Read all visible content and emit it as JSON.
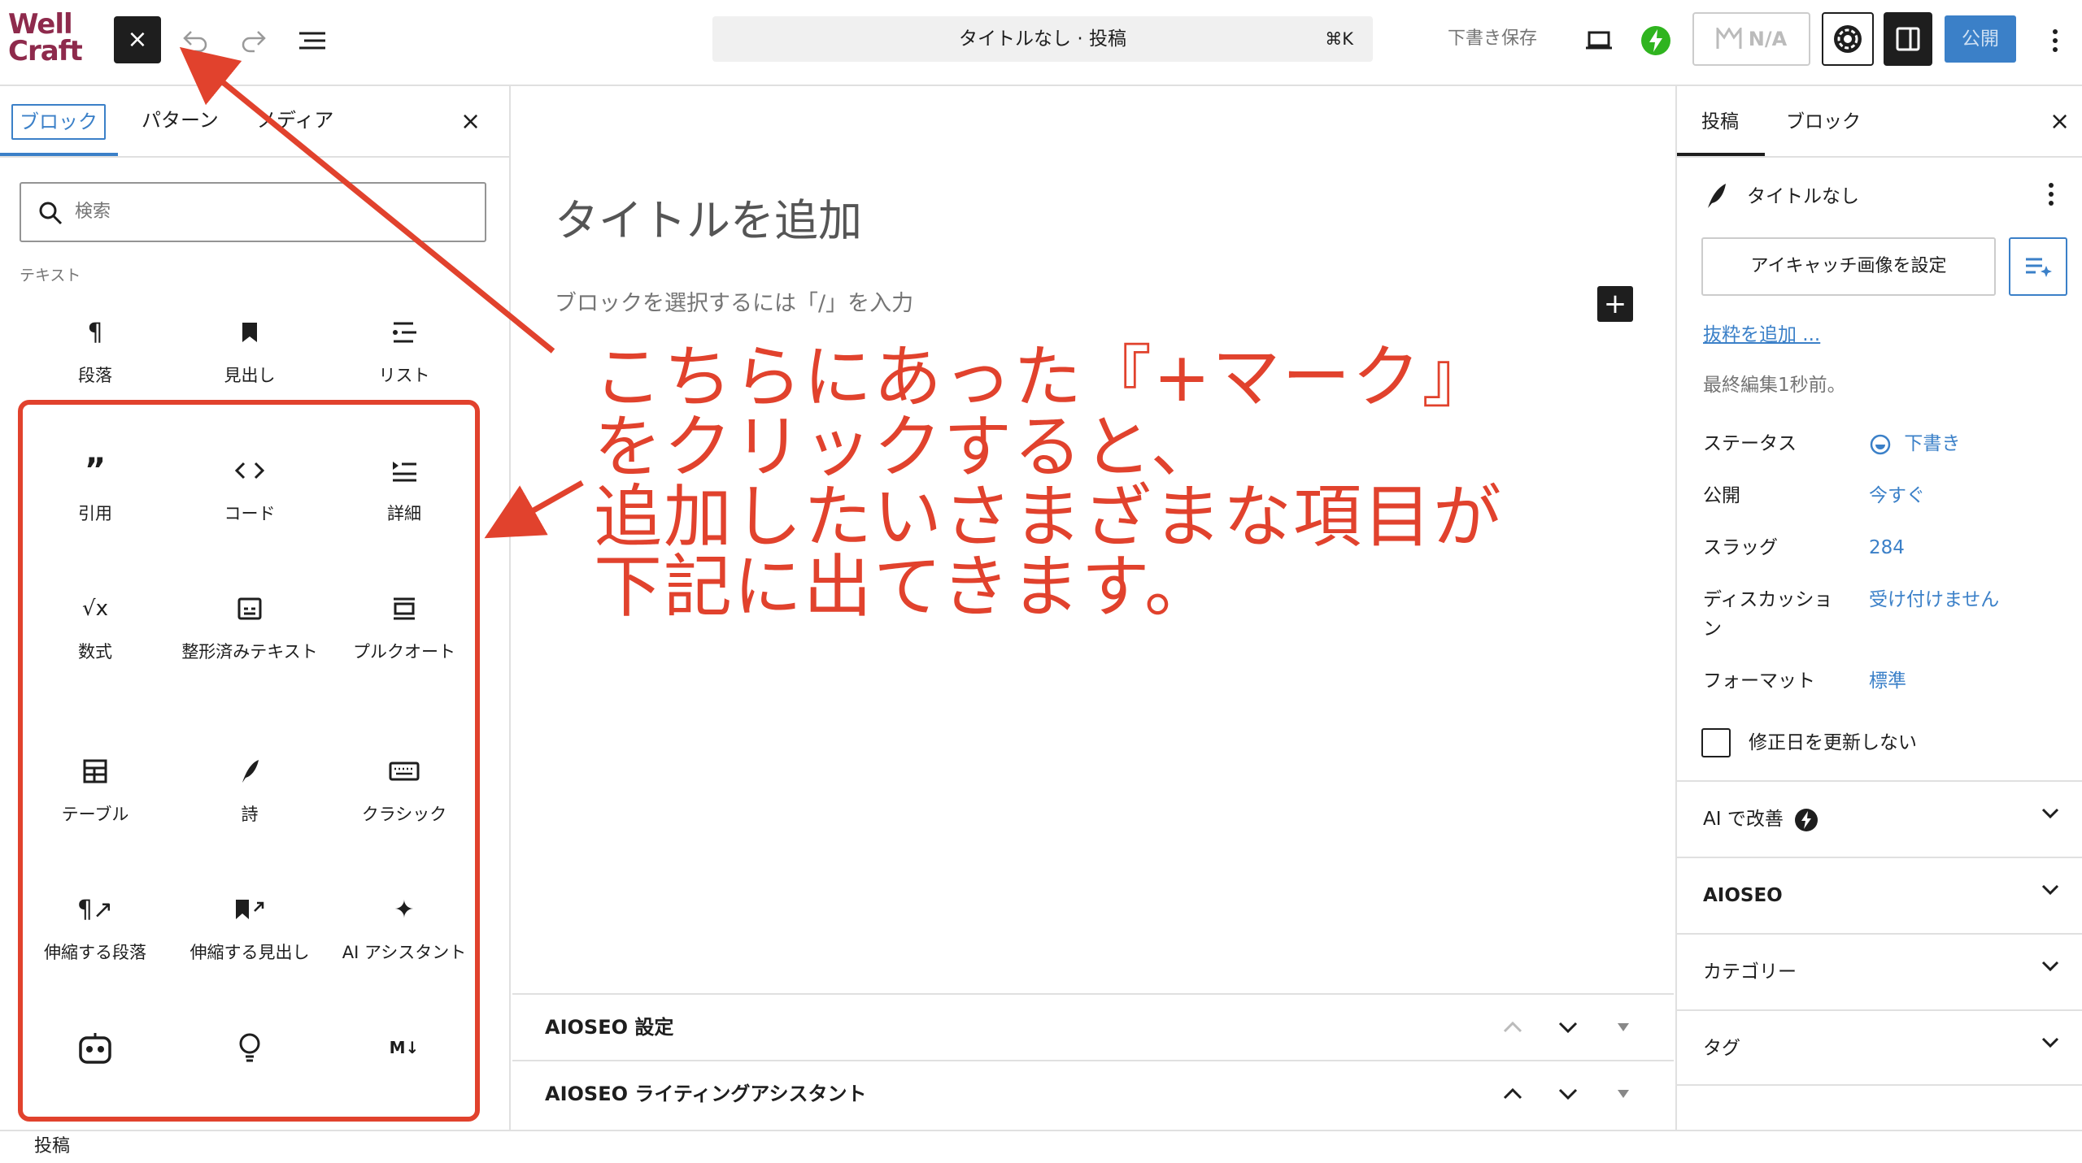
{
  "colors": {
    "accent": "#3b80c8",
    "annotation": "#e1422d",
    "logo": "#8e2a4c"
  },
  "topbar": {
    "logo_line1": "Well",
    "logo_line2": "Craft",
    "close_label": "×",
    "command_title": "タイトルなし · 投稿",
    "command_shortcut": "⌘K",
    "save_draft": "下書き保存",
    "plugin_label": "N/A",
    "publish": "公開"
  },
  "inserter": {
    "tabs": [
      "ブロック",
      "パターン",
      "メディア"
    ],
    "close": "×",
    "search_placeholder": "検索",
    "category": "テキスト",
    "blocks": [
      {
        "label": "段落",
        "icon": "paragraph-icon"
      },
      {
        "label": "見出し",
        "icon": "heading-icon"
      },
      {
        "label": "リスト",
        "icon": "list-icon"
      },
      {
        "label": "引用",
        "icon": "quote-icon"
      },
      {
        "label": "コード",
        "icon": "code-icon"
      },
      {
        "label": "詳細",
        "icon": "details-icon"
      },
      {
        "label": "数式",
        "icon": "math-icon"
      },
      {
        "label": "整形済みテキスト",
        "icon": "preformatted-icon"
      },
      {
        "label": "プルクオート",
        "icon": "pullquote-icon"
      },
      {
        "label": "テーブル",
        "icon": "table-icon"
      },
      {
        "label": "詩",
        "icon": "verse-icon"
      },
      {
        "label": "クラシック",
        "icon": "classic-icon"
      },
      {
        "label": "伸縮する段落",
        "icon": "fit-paragraph-icon"
      },
      {
        "label": "伸縮する見出し",
        "icon": "fit-heading-icon"
      },
      {
        "label": "AI アシスタント",
        "icon": "sparkles-icon"
      }
    ],
    "more_icons": [
      "robot-icon",
      "lightbulb-icon",
      "markdown-icon"
    ]
  },
  "canvas": {
    "title_placeholder": "タイトルを追加",
    "block_hint": "ブロックを選択するには「/」を入力",
    "add_block": "+",
    "annotation": "こちらにあった『+マーク』\nをクリックすると、\n追加したいさまざまな項目が\n下記に出てきます。",
    "metaboxes": [
      "AIOSEO 設定",
      "AIOSEO ライティングアシスタント"
    ]
  },
  "sidebar": {
    "tabs": [
      "投稿",
      "ブロック"
    ],
    "close": "×",
    "post_title": "タイトルなし",
    "featured_image": "アイキャッチ画像を設定",
    "excerpt_link": "抜粋を追加 ...",
    "last_edited": "最終編集1秒前。",
    "fields": [
      {
        "label": "ステータス",
        "value": "下書き"
      },
      {
        "label": "公開",
        "value": "今すぐ"
      },
      {
        "label": "スラッグ",
        "value": "284"
      },
      {
        "label": "ディスカッション",
        "value": "受け付けません"
      },
      {
        "label": "フォーマット",
        "value": "標準"
      }
    ],
    "checkbox_label": "修正日を更新しない",
    "sections": [
      "AI で改善",
      "AIOSEO",
      "カテゴリー",
      "タグ"
    ]
  },
  "statusbar": {
    "label": "投稿"
  }
}
